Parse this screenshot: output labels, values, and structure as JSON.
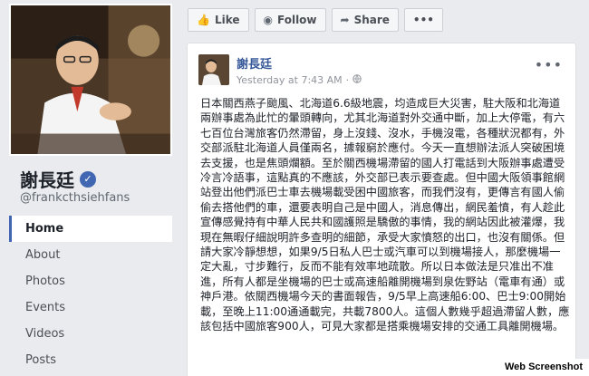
{
  "profile": {
    "name": "謝長廷",
    "handle": "@frankcthsiehfans",
    "verified_symbol": "✓"
  },
  "nav": {
    "items": [
      "Home",
      "About",
      "Photos",
      "Events",
      "Videos",
      "Posts"
    ],
    "active": "Home"
  },
  "toolbar": {
    "like": "Like",
    "follow": "Follow",
    "share": "Share",
    "more": "•••"
  },
  "post": {
    "author": "謝長廷",
    "timestamp": "Yesterday at 7:43 AM",
    "separator": "·",
    "more": "•••",
    "body": "日本關西燕子颱風、北海道6.6級地震，均造成巨大災害，駐大阪和北海道兩辦事處為此忙的暈頭轉向，尤其北海道對外交通中斷，加上大停電，有六七百位台灣旅客仍然滯留，身上沒錢、沒水，手機沒電，各種狀況都有，外交部派駐北海道人員僅兩名，據報窮於應付。今天一直想辦法派人突破困境去支援，也是焦頭爛額。至於關西機場滯留的國人打電話到大阪辦事處遭受冷言冷語事，這點真的不應該，外交部已表示要查處。但中國大阪領事館網站登出他們派巴士車去機場載受困中國旅客，而我們沒有，更傳言有國人偷偷去搭他們的車，還要表明自己是中國人，消息傳出，網民羞憤，有人趁此宣傳感覺持有中華人民共和國護照是驕傲的事情，我的網站因此被灌爆，我現在無暇仔細說明許多查明的細節，承受大家憤怒的出口，也沒有關係。但請大家冷靜想想，如果9/5日私人巴士或汽車可以到機場接人，那麼機場一定大亂，寸步難行，反而不能有效率地疏散。所以日本做法是只准出不准進，所有人都是坐機場的巴士或高速船離開機場到泉佐野站（電車有通）或神戶港。依關西機場今天的書面報告，9/5早上高速船6:00、巴士9:00開始載，至晚上11:00通通載完，共載7800人。這個人數幾乎超過滯留人數，應該包括中國旅客900人，可見大家都是搭乘機場安排的交通工具離開機場。"
  },
  "watermark": "Web Screenshot",
  "colors": {
    "fb_blue": "#4267b2",
    "link_blue": "#365899",
    "background": "#e9ebee"
  }
}
